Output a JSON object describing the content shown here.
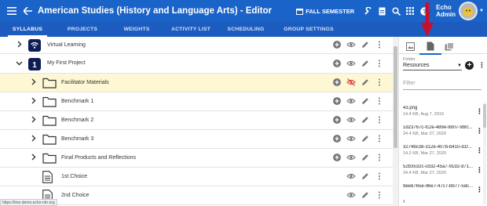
{
  "topbar": {
    "title": "American Studies (History and Language Arts) - Editor",
    "semester": "FALL SEMESTER",
    "user_line1": "Echo",
    "user_line2": "Admin",
    "color": "#1a63c9"
  },
  "tabs": [
    "SYLLABUS",
    "PROJECTS",
    "WEIGHTS",
    "ACTIVITY LIST",
    "SCHEDULING",
    "GROUP SETTINGS"
  ],
  "rows": [
    {
      "label": "Virtual Learning",
      "icon": "wifi-badge-icon",
      "chevron": "right"
    },
    {
      "label": "My First Project",
      "icon": "number-badge-icon",
      "badge": "1",
      "chevron": "down"
    },
    {
      "label": "Facilitator Materials",
      "icon": "folder-icon",
      "chevron": "right",
      "hidden": true
    },
    {
      "label": "Benchmark 1",
      "icon": "folder-icon",
      "chevron": "right"
    },
    {
      "label": "Benchmark 2",
      "icon": "folder-icon",
      "chevron": "right"
    },
    {
      "label": "Benchmark 3",
      "icon": "folder-icon",
      "chevron": "right"
    },
    {
      "label": "Final Products and Reflections",
      "icon": "folder-icon",
      "chevron": "right"
    },
    {
      "label": "1st Choice",
      "icon": "document-icon"
    },
    {
      "label": "2nd Choice",
      "icon": "document-icon"
    }
  ],
  "panel": {
    "folder_label": "Folder",
    "folder_value": "Resources",
    "filter_placeholder": "Filter",
    "files": [
      {
        "name": "43.png",
        "meta": "14.4 KB, Aug 7, 2019"
      },
      {
        "name": "1d23767c-fc2e-489e-9807-9bfc...",
        "meta": "24.4 KB, Mar 27, 2020"
      },
      {
        "name": "3274bc38-312e-407b-b410-d1f...",
        "meta": "14.2 KB, Mar 27, 2020"
      },
      {
        "name": "52b3532c-cd32-45a7-91d2-d71...",
        "meta": "24.4 KB, Mar 27, 2020"
      },
      {
        "name": "9ee8765e-96e7-47c7-bb77-5dc...",
        "meta": ""
      }
    ]
  },
  "status_url": "https://tms-demo.echo-ntn.org"
}
